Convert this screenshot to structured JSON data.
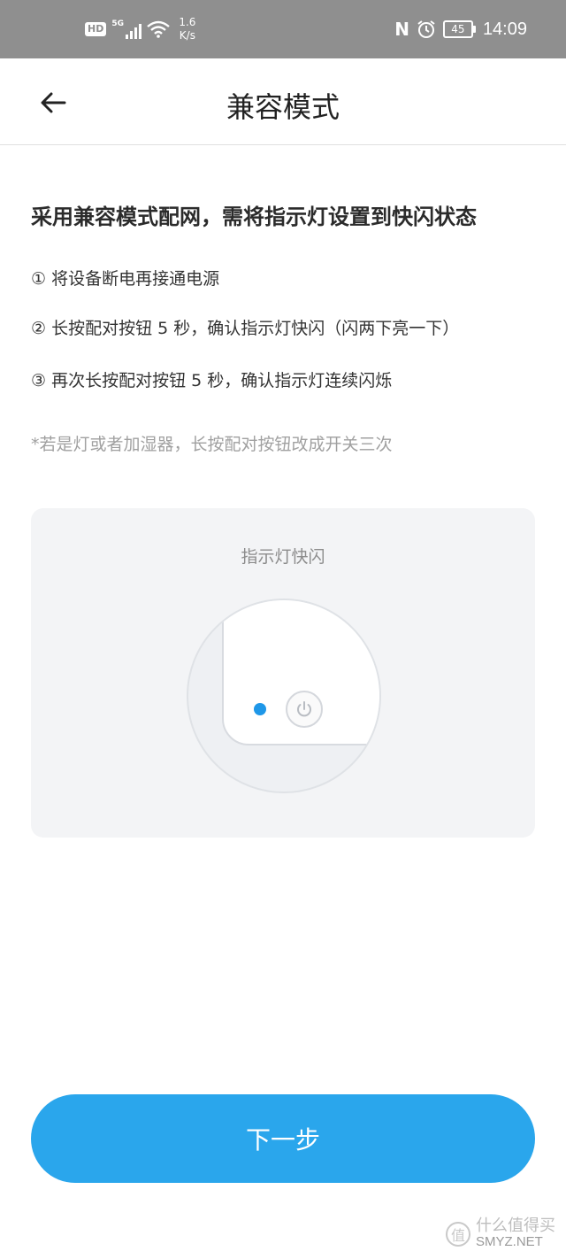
{
  "status_bar": {
    "hd": "HD",
    "network": "5G",
    "speed_value": "1.6",
    "speed_unit": "K/s",
    "nfc": "N",
    "battery": "45",
    "time": "14:09"
  },
  "header": {
    "title": "兼容模式",
    "back_icon": "arrow-left-icon"
  },
  "content": {
    "heading": "采用兼容模式配网，需将指示灯设置到快闪状态",
    "steps": [
      "① 将设备断电再接通电源",
      "② 长按配对按钮 5 秒，确认指示灯快闪（闪两下亮一下）",
      "③ 再次长按配对按钮 5 秒，确认指示灯连续闪烁"
    ],
    "note": "*若是灯或者加湿器，长按配对按钮改成开关三次"
  },
  "illustration": {
    "caption": "指示灯快闪",
    "led_color": "#1e97e8"
  },
  "actions": {
    "next_label": "下一步",
    "button_color": "#2aa6ec"
  },
  "watermark": {
    "logo": "值",
    "cn_text": "什么值得买",
    "en_text": "SMYZ.NET"
  }
}
